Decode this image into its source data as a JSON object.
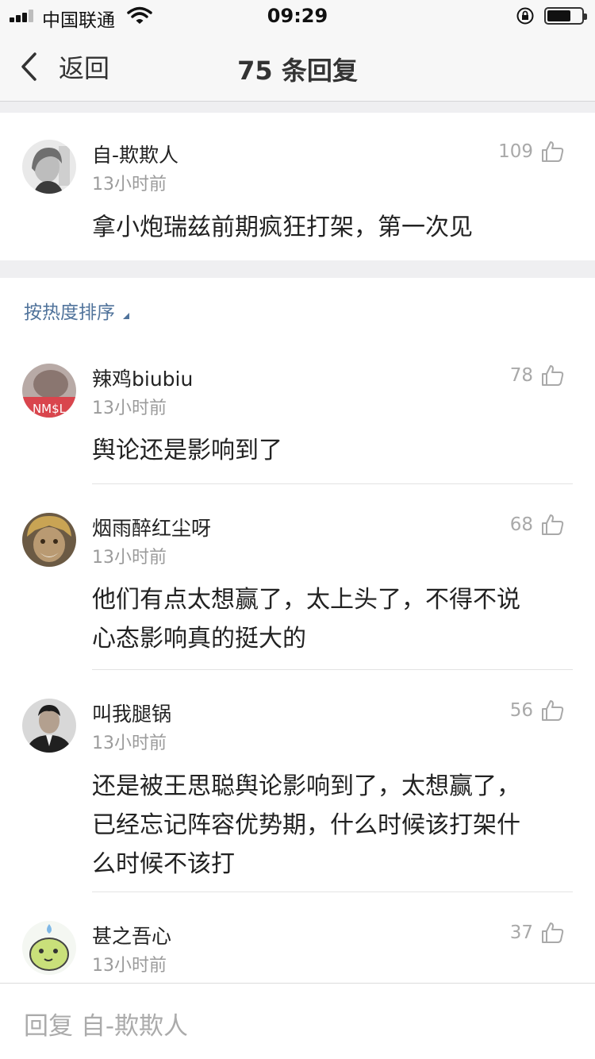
{
  "status_bar": {
    "carrier": "中国联通",
    "time": "09:29"
  },
  "nav": {
    "back_label": "返回",
    "title": "75 条回复"
  },
  "main_comment": {
    "username": "自-欺欺人",
    "time": "13小时前",
    "likes": "109",
    "text": "拿小炮瑞兹前期疯狂打架，第一次见"
  },
  "sort_label": "按热度排序",
  "replies": [
    {
      "username": "辣鸡biubiu",
      "time": "13小时前",
      "likes": "78",
      "lines": [
        "舆论还是影响到了"
      ],
      "avatar_text": "NM$L"
    },
    {
      "username": "烟雨醉红尘呀",
      "time": "13小时前",
      "likes": "68",
      "lines": [
        "他们有点太想赢了，太上头了，不得不说",
        "心态影响真的挺大的"
      ]
    },
    {
      "username": "叫我腿锅",
      "time": "13小时前",
      "likes": "56",
      "lines": [
        "还是被王思聪舆论影响到了，太想赢了，",
        "已经忘记阵容优势期，什么时候该打架什",
        "么时候不该打"
      ]
    },
    {
      "username": "甚之吾心",
      "time": "13小时前",
      "likes": "37",
      "lines": []
    }
  ],
  "reply_bar": {
    "placeholder": "回复 自-欺欺人"
  }
}
